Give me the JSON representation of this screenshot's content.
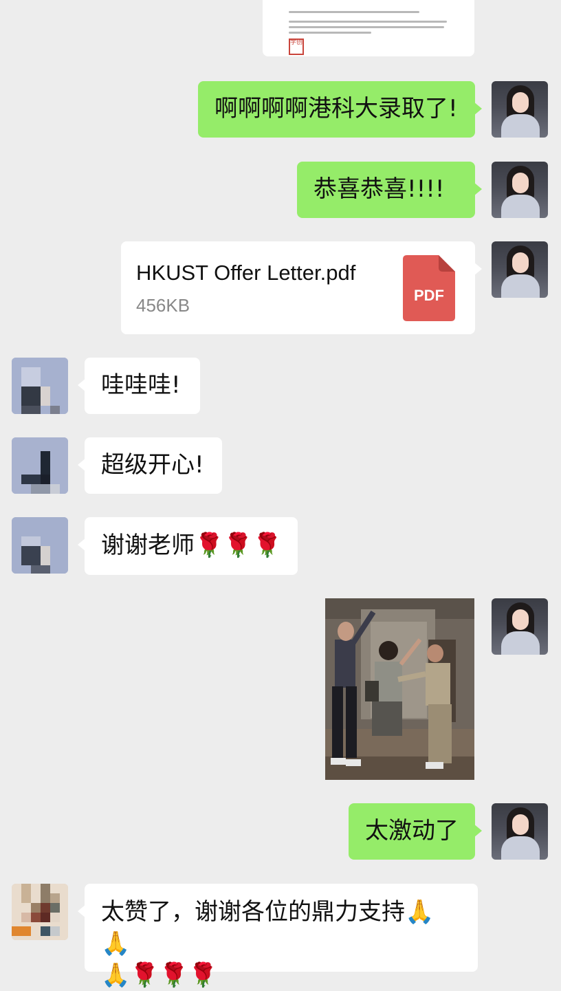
{
  "colors": {
    "background": "#ededed",
    "sent_bubble": "#95ec69",
    "received_bubble": "#ffffff",
    "pdf_icon": "#e05a55"
  },
  "messages": [
    {
      "id": "m1",
      "side": "sent",
      "type": "text",
      "text": "啊啊啊啊港科大录取了!"
    },
    {
      "id": "m2",
      "side": "sent",
      "type": "text",
      "text": "恭喜恭喜!!!!"
    },
    {
      "id": "m3",
      "side": "sent",
      "type": "file",
      "file_name": "HKUST Offer Letter.pdf",
      "file_size": "456KB",
      "file_icon_label": "PDF",
      "icon": "pdf-file-icon"
    },
    {
      "id": "m4",
      "side": "received",
      "type": "text",
      "text": "哇哇哇!"
    },
    {
      "id": "m5",
      "side": "received",
      "type": "text",
      "text": "超级开心!"
    },
    {
      "id": "m6",
      "side": "received",
      "type": "text",
      "text": "谢谢老师",
      "emoji": "🌹🌹🌹"
    },
    {
      "id": "m7",
      "side": "sent",
      "type": "image",
      "content": "celebration-gif"
    },
    {
      "id": "m8",
      "side": "sent",
      "type": "text",
      "text": "太激动了"
    },
    {
      "id": "m9",
      "side": "received",
      "type": "text",
      "text": "太赞了，谢谢各位的鼎力支持",
      "emoji_line1": "🙏🙏",
      "emoji_line2_hands": "🙏",
      "emoji_line2_roses": "🌹🌹🌹"
    }
  ],
  "document_preview": {
    "type": "image",
    "seal_text": "学创"
  }
}
